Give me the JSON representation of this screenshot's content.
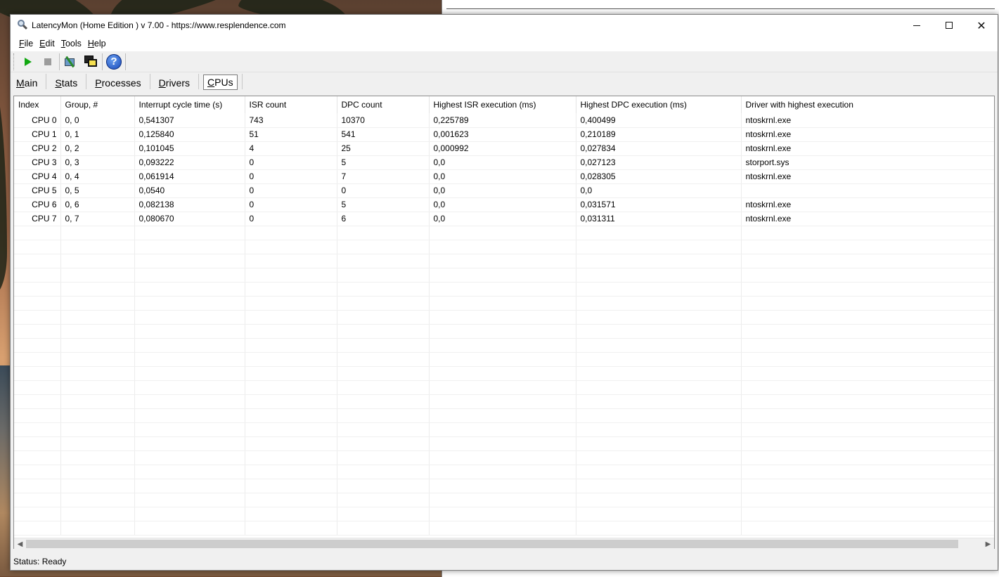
{
  "window": {
    "title": "LatencyMon  (Home Edition )  v 7.00 - https://www.resplendence.com"
  },
  "menu": [
    {
      "accel": "F",
      "rest": "ile"
    },
    {
      "accel": "E",
      "rest": "dit"
    },
    {
      "accel": "T",
      "rest": "ools"
    },
    {
      "accel": "H",
      "rest": "elp"
    }
  ],
  "toolbar": {
    "icons": [
      "play-icon",
      "stop-icon",
      "driver-wizard-icon",
      "windows-icon",
      "help-icon"
    ]
  },
  "tabs": [
    {
      "accel": "M",
      "rest": "ain",
      "active": false
    },
    {
      "accel": "S",
      "rest": "tats",
      "active": false
    },
    {
      "accel": "P",
      "rest": "rocesses",
      "active": false
    },
    {
      "accel": "D",
      "rest": "rivers",
      "active": false
    },
    {
      "accel": "C",
      "rest": "PUs",
      "active": true
    }
  ],
  "table": {
    "columns": [
      "Index",
      "Group, #",
      "Interrupt cycle time (s)",
      "ISR count",
      "DPC count",
      "Highest ISR execution (ms)",
      "Highest DPC execution (ms)",
      "Driver with highest execution"
    ],
    "rows": [
      [
        "CPU 0",
        "0, 0",
        "0,541307",
        "743",
        "10370",
        "0,225789",
        "0,400499",
        "ntoskrnl.exe"
      ],
      [
        "CPU 1",
        "0, 1",
        "0,125840",
        "51",
        "541",
        "0,001623",
        "0,210189",
        "ntoskrnl.exe"
      ],
      [
        "CPU 2",
        "0, 2",
        "0,101045",
        "4",
        "25",
        "0,000992",
        "0,027834",
        "ntoskrnl.exe"
      ],
      [
        "CPU 3",
        "0, 3",
        "0,093222",
        "0",
        "5",
        "0,0",
        "0,027123",
        "storport.sys"
      ],
      [
        "CPU 4",
        "0, 4",
        "0,061914",
        "0",
        "7",
        "0,0",
        "0,028305",
        "ntoskrnl.exe"
      ],
      [
        "CPU 5",
        "0, 5",
        "0,0540",
        "0",
        "0",
        "0,0",
        "0,0",
        ""
      ],
      [
        "CPU 6",
        "0, 6",
        "0,082138",
        "0",
        "5",
        "0,0",
        "0,031571",
        "ntoskrnl.exe"
      ],
      [
        "CPU 7",
        "0, 7",
        "0,080670",
        "0",
        "6",
        "0,0",
        "0,031311",
        "ntoskrnl.exe"
      ]
    ]
  },
  "status": {
    "text": "Status: Ready"
  }
}
